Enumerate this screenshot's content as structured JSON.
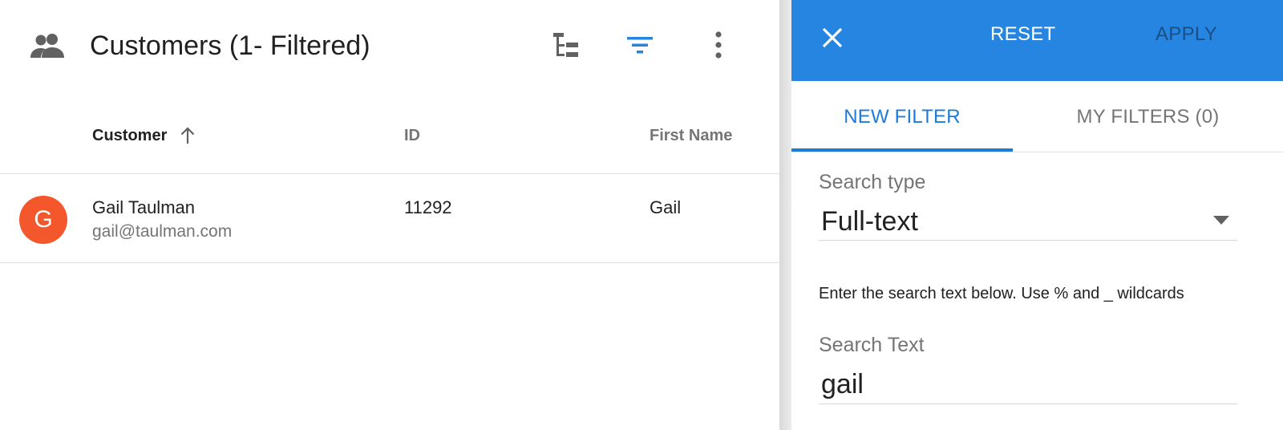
{
  "list": {
    "title": "Customers (1- Filtered)",
    "icons": {
      "title": "people-icon",
      "tree": "tree-view-icon",
      "filter": "filter-icon",
      "more": "more-vert-icon",
      "sort": "arrow-upward-icon"
    },
    "columns": [
      "Customer",
      "ID",
      "First Name"
    ],
    "rows": [
      {
        "avatar_letter": "G",
        "avatar_color": "#f4572b",
        "name": "Gail Taulman",
        "email": "gail@taulman.com",
        "id": "11292",
        "first_name": "Gail"
      }
    ]
  },
  "drawer": {
    "close_icon": "close-icon",
    "reset_label": "RESET",
    "apply_label": "APPLY",
    "tabs": [
      {
        "label": "NEW FILTER",
        "active": true
      },
      {
        "label": "MY FILTERS (0)",
        "active": false
      }
    ],
    "search_type": {
      "label": "Search type",
      "value": "Full-text"
    },
    "help_text": "Enter the search text below. Use % and _ wildcards",
    "search_text": {
      "label": "Search Text",
      "value": "gail"
    }
  },
  "colors": {
    "accent": "#2685e0",
    "tab_active": "#1e7ad6",
    "apply_text": "#1a4f86",
    "avatar": "#f4572b"
  }
}
